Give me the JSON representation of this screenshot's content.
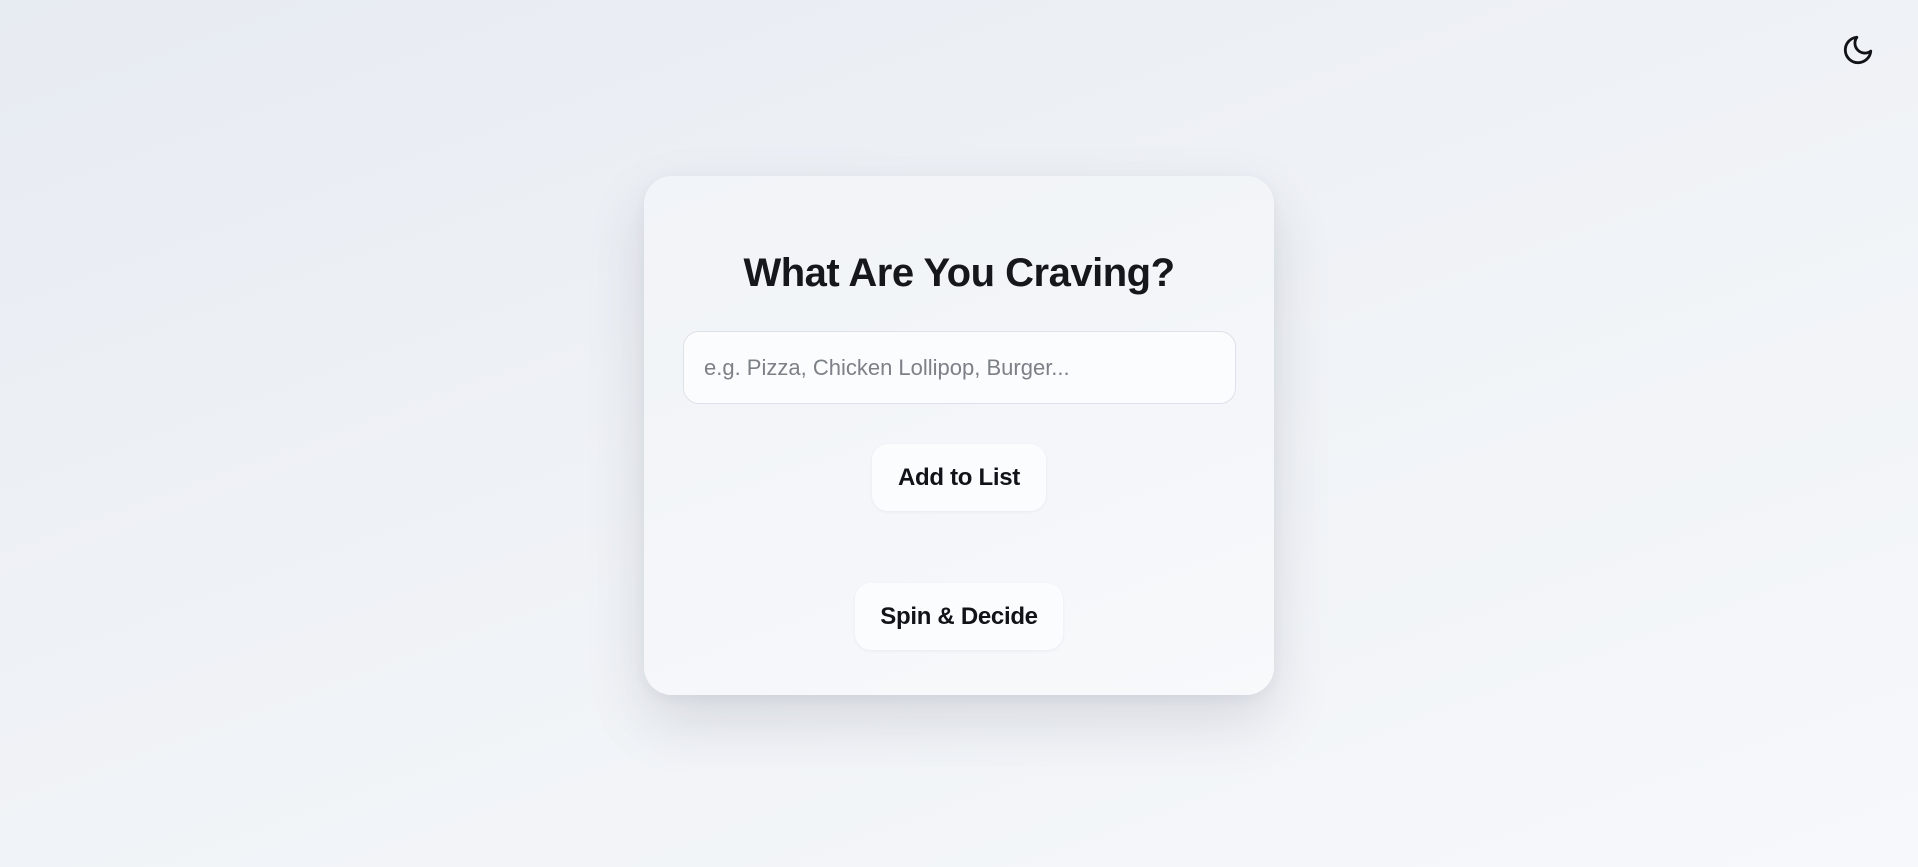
{
  "theme_toggle": {
    "icon": "moon-icon"
  },
  "card": {
    "title": "What Are You Craving?",
    "input": {
      "value": "",
      "placeholder": "e.g. Pizza, Chicken Lollipop, Burger..."
    },
    "add_button_label": "Add to List",
    "spin_button_label": "Spin & Decide"
  }
}
